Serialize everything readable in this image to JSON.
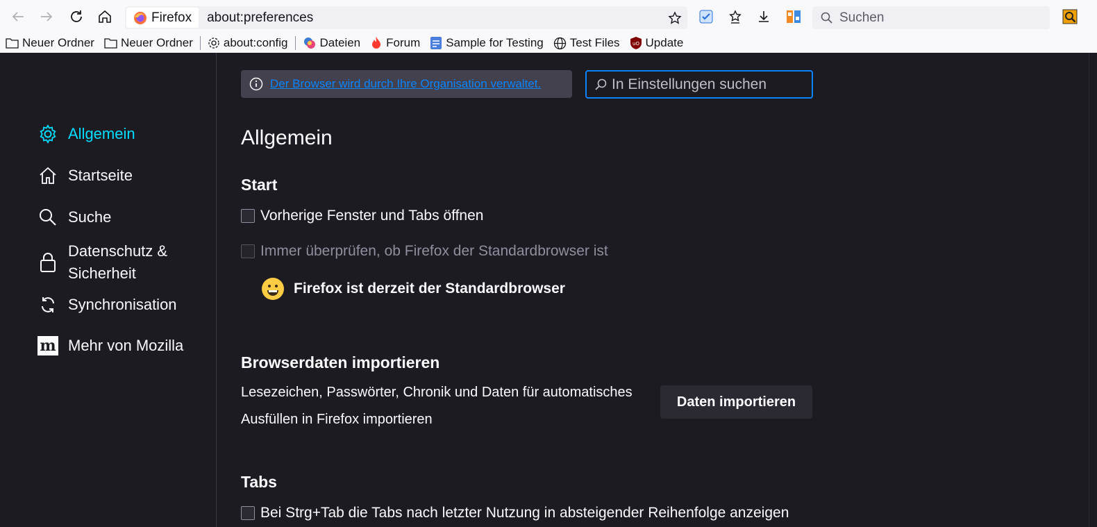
{
  "toolbar": {
    "identity_label": "Firefox",
    "url": "about:preferences",
    "search_placeholder": "Suchen"
  },
  "bookmarks": [
    {
      "label": "Neuer Ordner",
      "icon": "folder-icon"
    },
    {
      "label": "Neuer Ordner",
      "icon": "folder-icon"
    },
    {
      "label": "about:config",
      "icon": "gear-icon"
    },
    {
      "label": "Dateien",
      "icon": "files-icon"
    },
    {
      "label": "Forum",
      "icon": "flame-icon"
    },
    {
      "label": "Sample for Testing",
      "icon": "document-icon"
    },
    {
      "label": "Test Files",
      "icon": "globe-icon"
    },
    {
      "label": "Update",
      "icon": "ublock-icon"
    }
  ],
  "sidebar": {
    "items": [
      {
        "label": "Allgemein",
        "icon": "gear-icon",
        "selected": true
      },
      {
        "label": "Startseite",
        "icon": "home-icon"
      },
      {
        "label": "Suche",
        "icon": "search-icon"
      },
      {
        "label": "Datenschutz &",
        "label2": "Sicherheit",
        "icon": "lock-icon"
      },
      {
        "label": "Synchronisation",
        "icon": "sync-icon"
      },
      {
        "label": "Mehr von Mozilla",
        "icon": "mozilla-icon"
      }
    ]
  },
  "main": {
    "policies_link": "Der Browser wird durch Ihre Organisation verwaltet.",
    "search_placeholder": "In Einstellungen suchen",
    "title": "Allgemein",
    "start": {
      "heading": "Start",
      "restore_session": "Vorherige Fenster und Tabs öffnen",
      "check_default": "Immer überprüfen, ob Firefox der Standardbrowser ist",
      "is_default": "Firefox ist derzeit der Standardbrowser"
    },
    "import": {
      "heading": "Browserdaten importieren",
      "desc_line1": "Lesezeichen, Passwörter, Chronik und Daten für automatisches",
      "desc_line2": "Ausfüllen in Firefox importieren",
      "button": "Daten importieren"
    },
    "tabs": {
      "heading": "Tabs",
      "ctrl_tab": "Bei Strg+Tab die Tabs nach letzter Nutzung in absteigender Reihenfolge anzeigen"
    }
  },
  "colors": {
    "accent": "#00ddff",
    "link": "#0a84ff",
    "background": "#1c1b22"
  }
}
